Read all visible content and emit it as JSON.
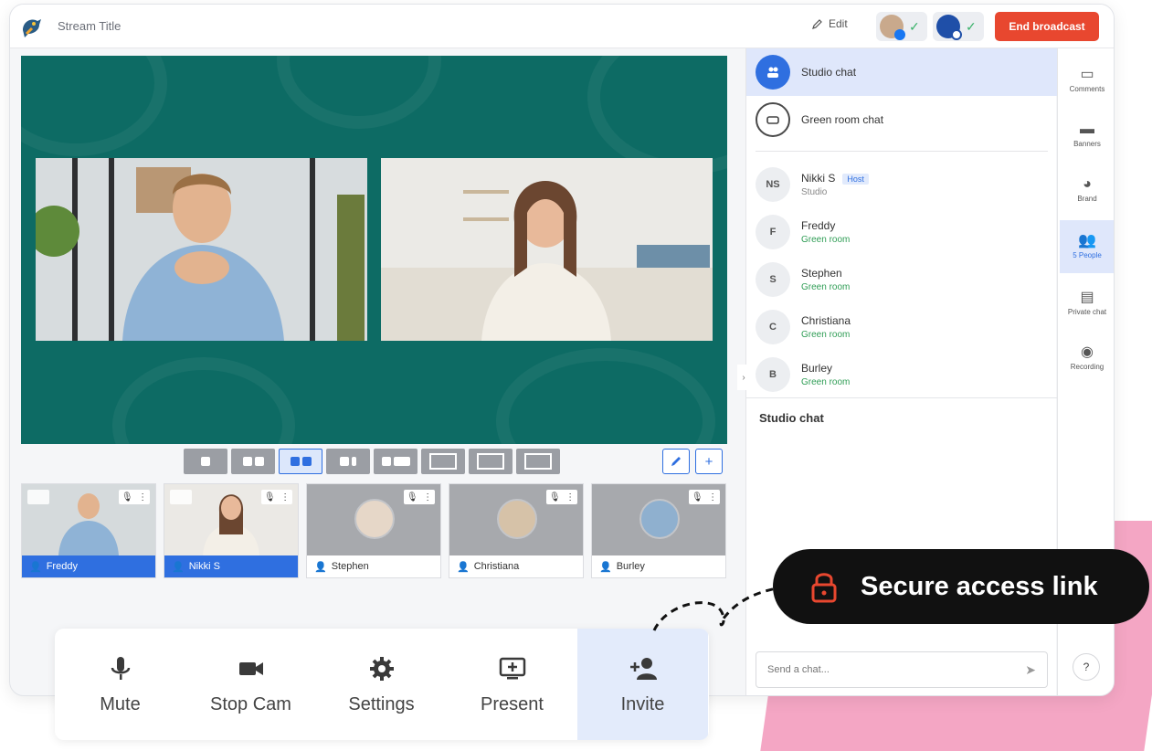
{
  "header": {
    "stream_title": "Stream Title",
    "edit_label": "Edit",
    "end_button": "End broadcast"
  },
  "layout_tools": {
    "edit_icon": "pencil-icon",
    "add_icon": "plus-icon",
    "add_label": "+"
  },
  "participants_strip": [
    {
      "name": "Freddy",
      "on_stage": true
    },
    {
      "name": "Nikki S",
      "on_stage": true
    },
    {
      "name": "Stephen",
      "on_stage": false
    },
    {
      "name": "Christiana",
      "on_stage": false
    },
    {
      "name": "Burley",
      "on_stage": false
    }
  ],
  "controls": {
    "mute": "Mute",
    "stop_cam": "Stop Cam",
    "settings": "Settings",
    "present": "Present",
    "invite": "Invite"
  },
  "panel": {
    "studio_chat": "Studio chat",
    "green_room_chat": "Green room chat",
    "people": [
      {
        "initials": "NS",
        "name": "Nikki S",
        "status": "Studio",
        "badge": "Host"
      },
      {
        "initials": "F",
        "name": "Freddy",
        "status": "Green room"
      },
      {
        "initials": "S",
        "name": "Stephen",
        "status": "Green room"
      },
      {
        "initials": "C",
        "name": "Christiana",
        "status": "Green room"
      },
      {
        "initials": "B",
        "name": "Burley",
        "status": "Green room"
      }
    ],
    "chat_section_title": "Studio chat",
    "chat_placeholder": "Send a chat..."
  },
  "rail": {
    "comments": "Comments",
    "banners": "Banners",
    "brand": "Brand",
    "people": "5 People",
    "private_chat": "Private chat",
    "recording": "Recording",
    "help": "?"
  },
  "callout": {
    "text": "Secure access link"
  },
  "colors": {
    "accent": "#2f6fe0",
    "end_button": "#e8472f",
    "stage_bg": "#0d6b64",
    "status_green": "#2f9d55",
    "callout_bg": "#111111",
    "blob": "#f4a6c4"
  }
}
